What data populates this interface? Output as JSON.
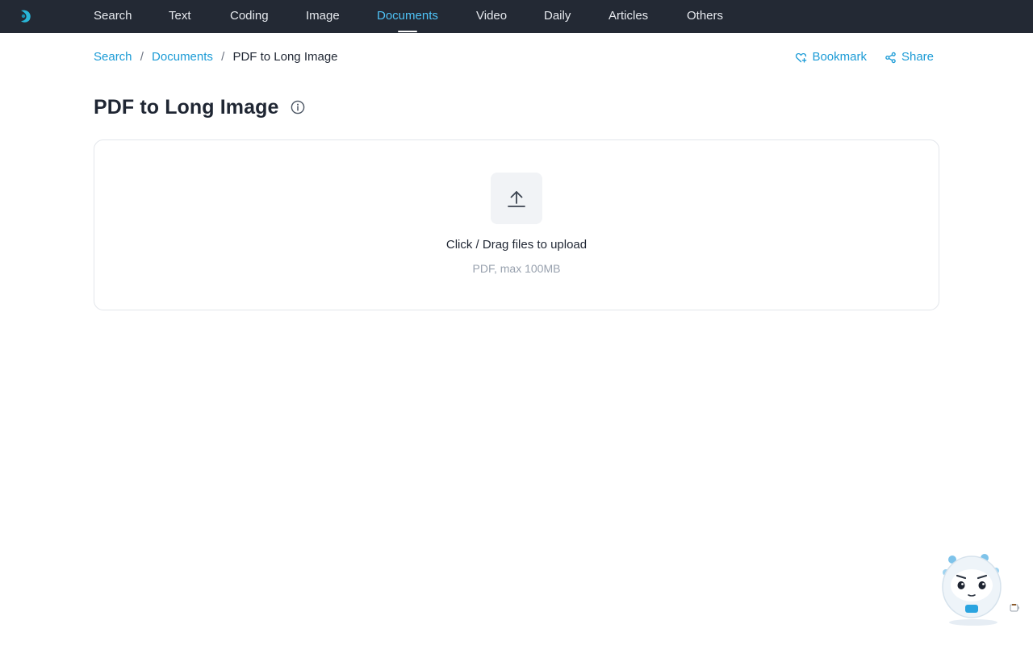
{
  "nav": {
    "items": [
      {
        "label": "Search",
        "active": false
      },
      {
        "label": "Text",
        "active": false
      },
      {
        "label": "Coding",
        "active": false
      },
      {
        "label": "Image",
        "active": false
      },
      {
        "label": "Documents",
        "active": true
      },
      {
        "label": "Video",
        "active": false
      },
      {
        "label": "Daily",
        "active": false
      },
      {
        "label": "Articles",
        "active": false
      },
      {
        "label": "Others",
        "active": false
      }
    ]
  },
  "breadcrumb": {
    "items": [
      "Search",
      "Documents"
    ],
    "separator": "/",
    "current": "PDF to Long Image"
  },
  "actions": {
    "bookmark_label": "Bookmark",
    "share_label": "Share"
  },
  "page": {
    "title": "PDF to Long Image"
  },
  "upload": {
    "label": "Click / Drag files to upload",
    "hint": "PDF, max 100MB"
  },
  "icons": {
    "logo": "logo-icon",
    "bookmark": "heart-plus-icon",
    "share": "share-icon",
    "info": "info-icon",
    "upload": "upload-arrow-icon",
    "mascot": "mascot-robot"
  },
  "colors": {
    "nav_bg": "#232934",
    "nav_active": "#4fc3f7",
    "link": "#1b9bd6",
    "title": "#1f2633",
    "hint": "#98a1ae"
  }
}
